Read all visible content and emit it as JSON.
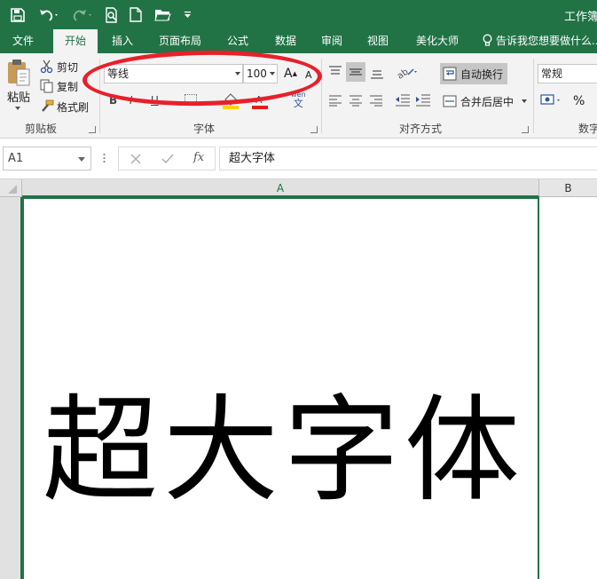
{
  "window": {
    "title": "工作簿",
    "accent_color": "#217346",
    "annotation_color": "#e8202a"
  },
  "quick_access": {
    "icons": [
      "save-icon",
      "undo-icon",
      "redo-icon",
      "print-preview-icon",
      "new-file-icon",
      "open-folder-icon",
      "customize-icon"
    ]
  },
  "tabs": [
    {
      "label": "文件",
      "active": false
    },
    {
      "label": "开始",
      "active": true
    },
    {
      "label": "插入",
      "active": false
    },
    {
      "label": "页面布局",
      "active": false
    },
    {
      "label": "公式",
      "active": false
    },
    {
      "label": "数据",
      "active": false
    },
    {
      "label": "审阅",
      "active": false
    },
    {
      "label": "视图",
      "active": false
    },
    {
      "label": "美化大师",
      "active": false
    }
  ],
  "tell_me": "告诉我您想要做什么...",
  "clipboard": {
    "paste_label": "粘贴",
    "cut_label": "剪切",
    "copy_label": "复制",
    "format_painter_label": "格式刷",
    "group_label": "剪贴板"
  },
  "font": {
    "font_name": "等线",
    "font_size": "100",
    "group_label": "字体",
    "grow_label": "A",
    "shrink_label": "A",
    "bold_label": "B",
    "italic_label": "I",
    "underline_label": "U",
    "phonetic_label": "wén"
  },
  "alignment": {
    "wrap_text_label": "自动换行",
    "merge_center_label": "合并后居中",
    "group_label": "对齐方式"
  },
  "number": {
    "format_value": "常规",
    "percent_label": "%",
    "group_label": "数字"
  },
  "formula_bar": {
    "name_box": "A1",
    "fx_label": "fx",
    "formula": "超大字体"
  },
  "sheet": {
    "col_a": "A",
    "col_b": "B",
    "cell_a1": "超大字体"
  }
}
